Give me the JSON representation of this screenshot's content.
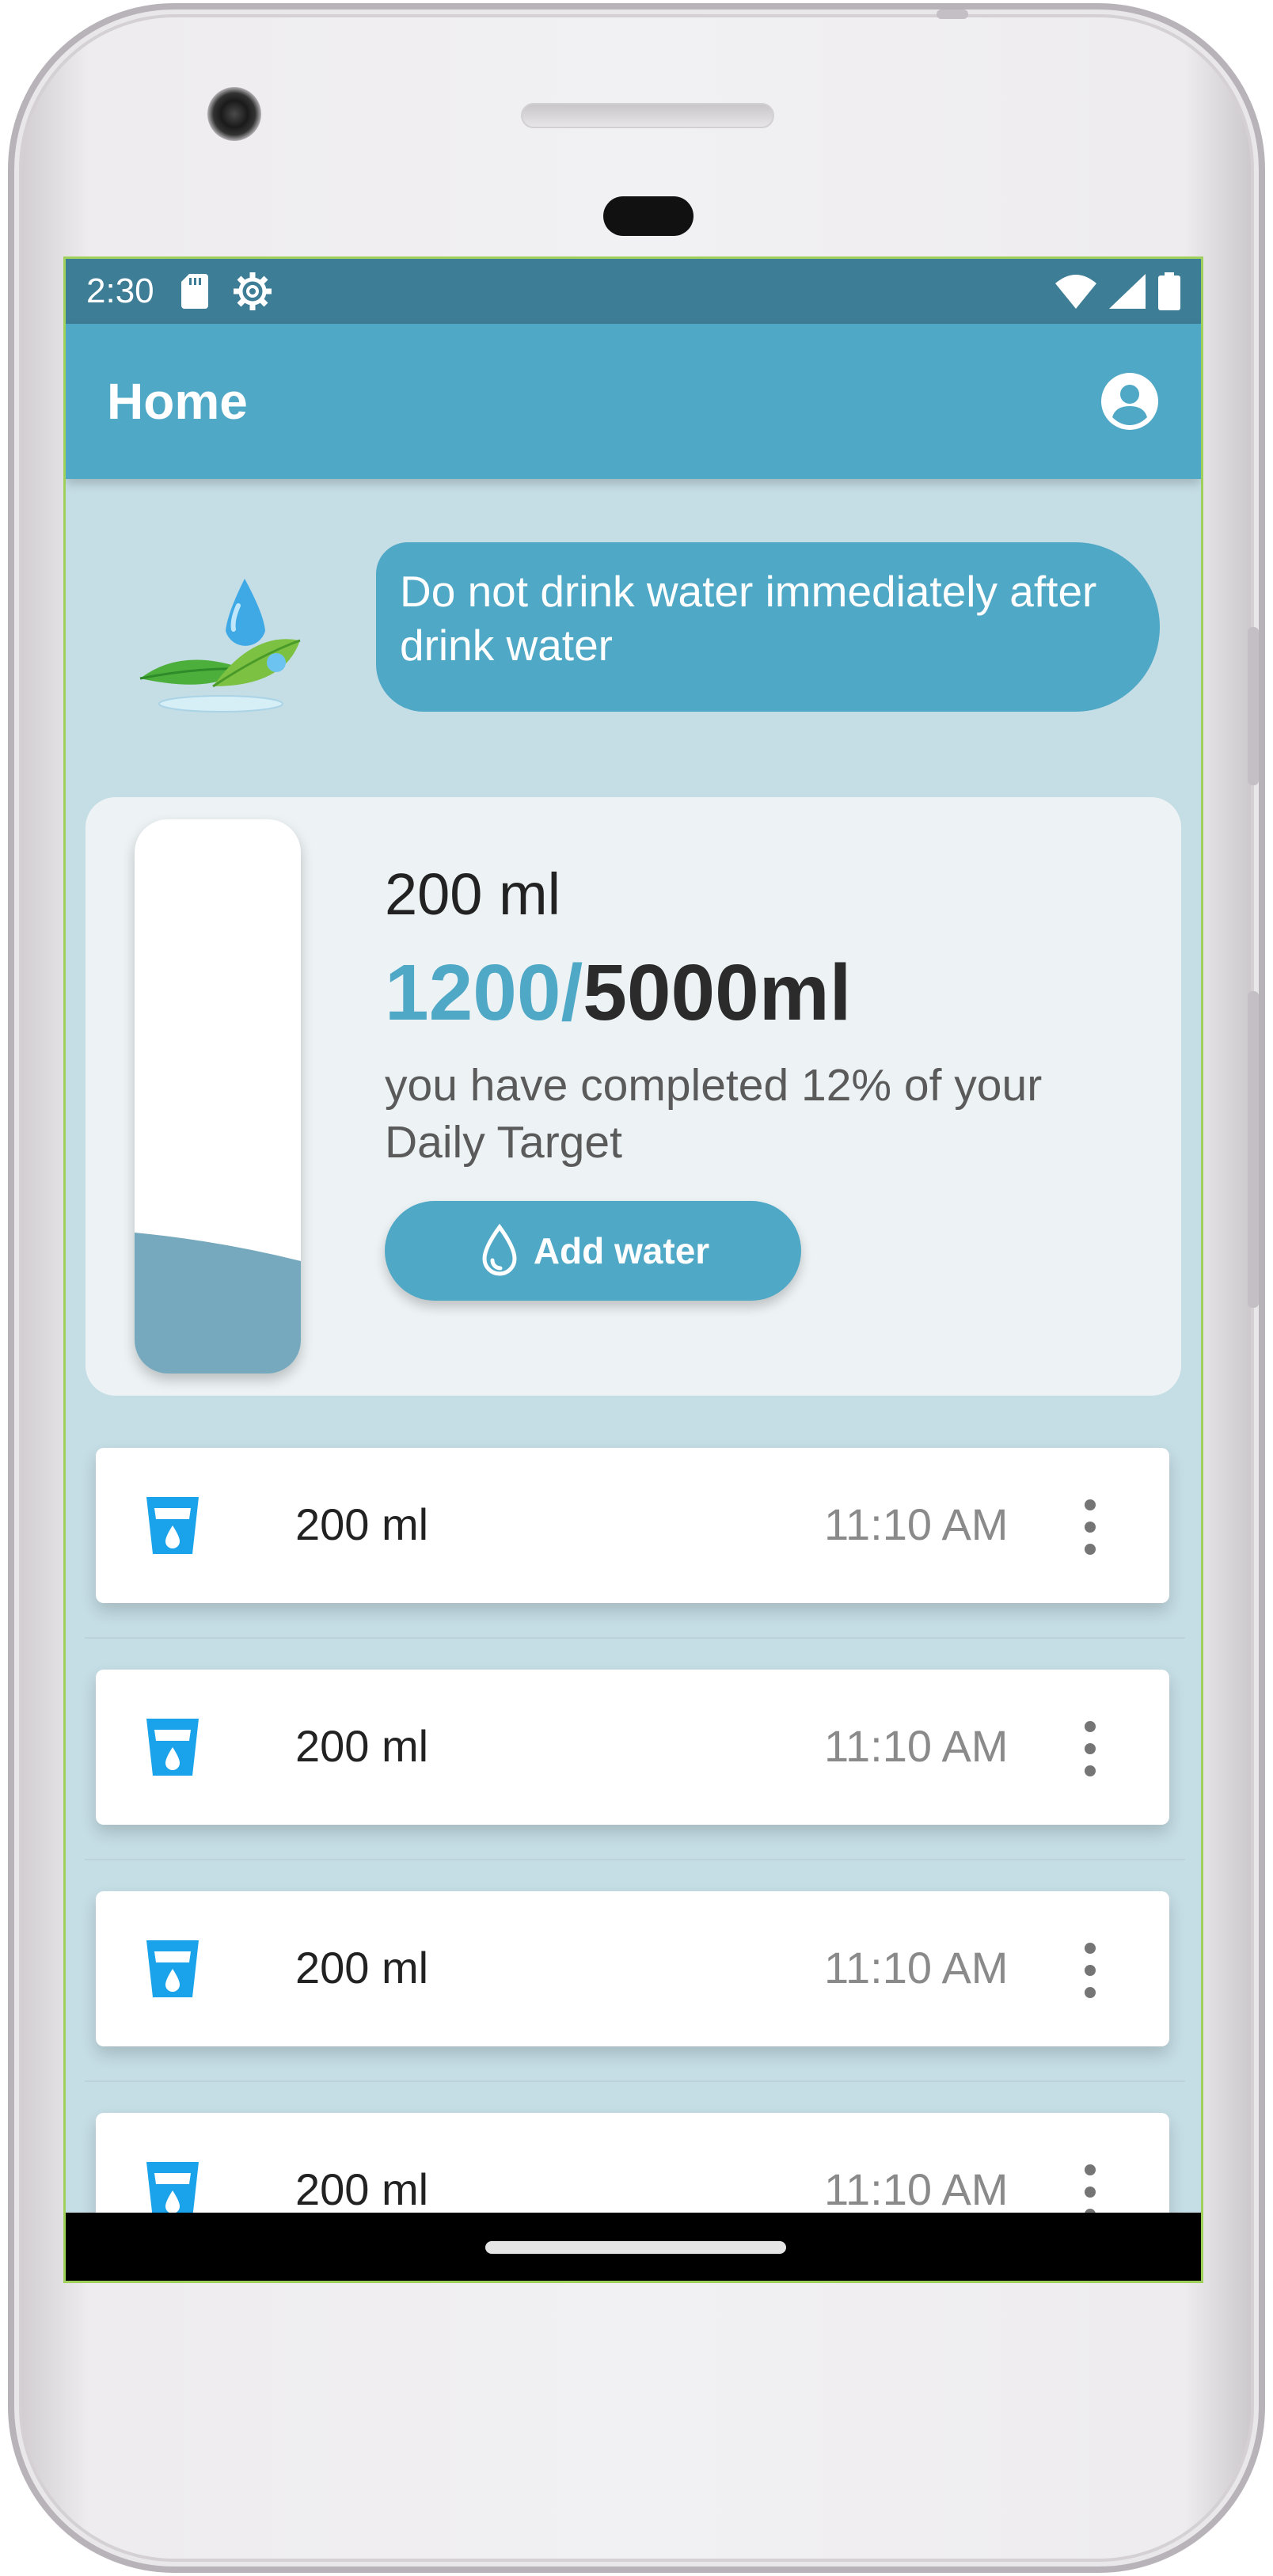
{
  "status_bar": {
    "time": "2:30",
    "icons": [
      "sd-card-icon",
      "gear-icon",
      "wifi-icon",
      "signal-icon",
      "battery-icon"
    ]
  },
  "app_bar": {
    "title": "Home",
    "account_icon": "account-circle-icon"
  },
  "tip": {
    "text": "Do not drink water immediately after drink water",
    "image_icon": "water-drop-leaf-icon"
  },
  "progress": {
    "selected_amount": "200 ml",
    "current": "1200/",
    "target": "5000ml",
    "message": "you have completed 12% of your Daily Target",
    "fill_fraction": 0.24,
    "add_button_label": "Add water"
  },
  "intake_log": [
    {
      "amount": "200 ml",
      "time": "11:10 AM"
    },
    {
      "amount": "200 ml",
      "time": "11:10 AM"
    },
    {
      "amount": "200 ml",
      "time": "11:10 AM"
    },
    {
      "amount": "200 ml",
      "time": "11:10 AM"
    }
  ],
  "colors": {
    "primary": "#4fa8c6",
    "status_bar": "#3e7d96",
    "background": "#c5dde5",
    "cup_icon": "#1aa3ea",
    "water_fill": "#76a9bd"
  }
}
